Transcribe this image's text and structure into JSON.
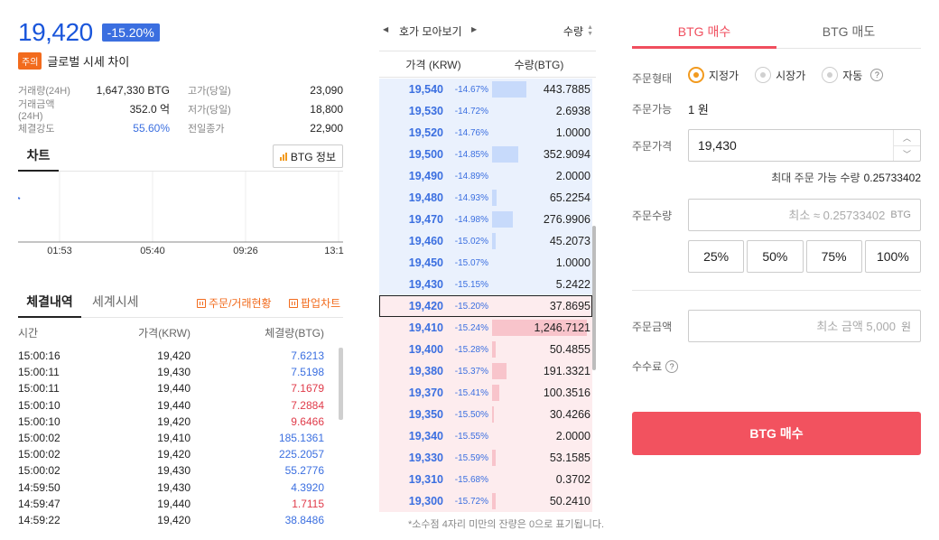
{
  "ticker": {
    "price": "19,420",
    "change": "-15.20%",
    "warning_tag": "주의",
    "warning_text": "글로벌 시세 차이"
  },
  "stats": [
    {
      "label": "거래량(24H)",
      "value": "1,647,330 BTG",
      "label2": "고가(당일)",
      "value2": "23,090"
    },
    {
      "label": "거래금액(24H)",
      "value": "352.0 억",
      "label2": "저가(당일)",
      "value2": "18,800"
    },
    {
      "label": "체결강도",
      "value": "55.60%",
      "label2": "전일종가",
      "value2": "22,900"
    }
  ],
  "chart": {
    "tab": "차트",
    "info_button": "BTG 정보",
    "ticks": [
      "01:53",
      "05:40",
      "09:26",
      "13:1"
    ]
  },
  "trades": {
    "tab_active": "체결내역",
    "tab_other": "세계시세",
    "link_orders": "주문/거래현황",
    "link_popup": "팝업차트",
    "headers": {
      "time": "시간",
      "price": "가격(KRW)",
      "qty": "체결량(BTG)"
    },
    "rows": [
      {
        "time": "15:00:16",
        "price": "19,420",
        "qty": "7.6213",
        "side": "down"
      },
      {
        "time": "15:00:11",
        "price": "19,430",
        "qty": "7.5198",
        "side": "down"
      },
      {
        "time": "15:00:11",
        "price": "19,440",
        "qty": "7.1679",
        "side": "up"
      },
      {
        "time": "15:00:10",
        "price": "19,440",
        "qty": "7.2884",
        "side": "up"
      },
      {
        "time": "15:00:10",
        "price": "19,420",
        "qty": "9.6466",
        "side": "up"
      },
      {
        "time": "15:00:02",
        "price": "19,410",
        "qty": "185.1361",
        "side": "down"
      },
      {
        "time": "15:00:02",
        "price": "19,420",
        "qty": "225.2057",
        "side": "down"
      },
      {
        "time": "15:00:02",
        "price": "19,430",
        "qty": "55.2776",
        "side": "down"
      },
      {
        "time": "14:59:50",
        "price": "19,430",
        "qty": "4.3920",
        "side": "down"
      },
      {
        "time": "14:59:47",
        "price": "19,440",
        "qty": "1.7115",
        "side": "up"
      },
      {
        "time": "14:59:22",
        "price": "19,420",
        "qty": "38.8486",
        "side": "down"
      }
    ]
  },
  "orderbook": {
    "group_label": "호가 모아보기",
    "sort_label": "수량",
    "header_price": "가격 (KRW)",
    "header_qty": "수량(BTG)",
    "note": "*소수점 4자리 미만의 잔량은 0으로 표기됩니다.",
    "rows": [
      {
        "price": "19,540",
        "pct": "-14.67%",
        "qty": "443.7885",
        "side": "ask",
        "bar": 0.36
      },
      {
        "price": "19,530",
        "pct": "-14.72%",
        "qty": "2.6938",
        "side": "ask",
        "bar": 0.0
      },
      {
        "price": "19,520",
        "pct": "-14.76%",
        "qty": "1.0000",
        "side": "ask",
        "bar": 0.0
      },
      {
        "price": "19,500",
        "pct": "-14.85%",
        "qty": "352.9094",
        "side": "ask",
        "bar": 0.28
      },
      {
        "price": "19,490",
        "pct": "-14.89%",
        "qty": "2.0000",
        "side": "ask",
        "bar": 0.0
      },
      {
        "price": "19,480",
        "pct": "-14.93%",
        "qty": "65.2254",
        "side": "ask",
        "bar": 0.05
      },
      {
        "price": "19,470",
        "pct": "-14.98%",
        "qty": "276.9906",
        "side": "ask",
        "bar": 0.22
      },
      {
        "price": "19,460",
        "pct": "-15.02%",
        "qty": "45.2073",
        "side": "ask",
        "bar": 0.04
      },
      {
        "price": "19,450",
        "pct": "-15.07%",
        "qty": "1.0000",
        "side": "ask",
        "bar": 0.0
      },
      {
        "price": "19,430",
        "pct": "-15.15%",
        "qty": "5.2422",
        "side": "ask",
        "bar": 0.0
      },
      {
        "price": "19,420",
        "pct": "-15.20%",
        "qty": "37.8695",
        "side": "cur",
        "bar": 0.0
      },
      {
        "price": "19,410",
        "pct": "-15.24%",
        "qty": "1,246.7121",
        "side": "bid",
        "bar": 1.0
      },
      {
        "price": "19,400",
        "pct": "-15.28%",
        "qty": "50.4855",
        "side": "bid",
        "bar": 0.04
      },
      {
        "price": "19,380",
        "pct": "-15.37%",
        "qty": "191.3321",
        "side": "bid",
        "bar": 0.15
      },
      {
        "price": "19,370",
        "pct": "-15.41%",
        "qty": "100.3516",
        "side": "bid",
        "bar": 0.08
      },
      {
        "price": "19,350",
        "pct": "-15.50%",
        "qty": "30.4266",
        "side": "bid",
        "bar": 0.02
      },
      {
        "price": "19,340",
        "pct": "-15.55%",
        "qty": "2.0000",
        "side": "bid",
        "bar": 0.0
      },
      {
        "price": "19,330",
        "pct": "-15.59%",
        "qty": "53.1585",
        "side": "bid",
        "bar": 0.04
      },
      {
        "price": "19,310",
        "pct": "-15.68%",
        "qty": "0.3702",
        "side": "bid",
        "bar": 0.0
      },
      {
        "price": "19,300",
        "pct": "-15.72%",
        "qty": "50.2410",
        "side": "bid",
        "bar": 0.04
      }
    ]
  },
  "order_form": {
    "tab_buy": "BTG 매수",
    "tab_sell": "BTG 매도",
    "type_label": "주문형태",
    "type_limit": "지정가",
    "type_market": "시장가",
    "type_auto": "자동",
    "avail_label": "주문가능",
    "avail_value": "1 원",
    "price_label": "주문가격",
    "price_value": "19,430",
    "max_label": "최대 주문 가능 수량",
    "max_value": "0.25733402",
    "qty_label": "주문수량",
    "qty_placeholder": "최소 ≈ 0.25733402",
    "qty_unit": "BTG",
    "pct_buttons": [
      "25%",
      "50%",
      "75%",
      "100%"
    ],
    "amount_label": "주문금액",
    "amount_placeholder": "최소 금액 5,000",
    "amount_unit": "원",
    "fee_label": "수수료",
    "submit": "BTG 매수"
  },
  "colors": {
    "accent_blue": "#3b6fe0",
    "accent_red": "#f04e5e",
    "warning_orange": "#f26b1d"
  }
}
